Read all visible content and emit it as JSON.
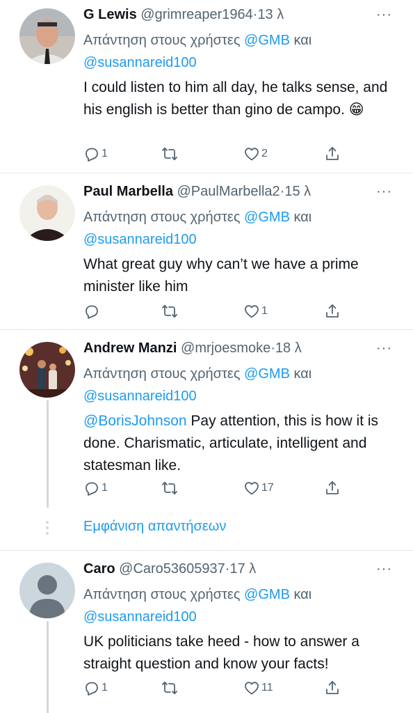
{
  "reply_prefix": "Απάντηση στους χρήστες",
  "conjunction": "και",
  "tweets": [
    {
      "name": "G Lewis",
      "handle": "@grimreaper1964",
      "time": "13 λ",
      "mentions": [
        "@GMB",
        "@susannareid100"
      ],
      "text": "I could listen to him all day, he talks sense, and his english is better than gino de campo. 😁",
      "replies": "1",
      "retweets": "",
      "likes": "2"
    },
    {
      "name": "Paul Marbella",
      "handle": "@PaulMarbella2",
      "time": "15 λ",
      "mentions": [
        "@GMB",
        "@susannareid100"
      ],
      "text": "What great guy why can’t we have a prime minister like him",
      "replies": "",
      "retweets": "",
      "likes": "1"
    },
    {
      "name": "Andrew Manzi",
      "handle": "@mrjoesmoke",
      "time": "18 λ",
      "mentions": [
        "@GMB",
        "@susannareid100"
      ],
      "text_mention": "@BorisJohnson",
      "text": " Pay attention, this is how it is done. Charismatic, articulate, intelligent and statesman like.",
      "replies": "1",
      "retweets": "",
      "likes": "17"
    },
    {
      "name": "Caro",
      "handle": "@Caro53605937",
      "time": "17 λ",
      "mentions": [
        "@GMB",
        "@susannareid100"
      ],
      "text": "UK politicians take heed - how to answer a straight question and know your facts!",
      "replies": "1",
      "retweets": "",
      "likes": "11"
    }
  ],
  "show_replies": "Εμφάνιση απαντήσεων",
  "dot": "·",
  "more": "···"
}
